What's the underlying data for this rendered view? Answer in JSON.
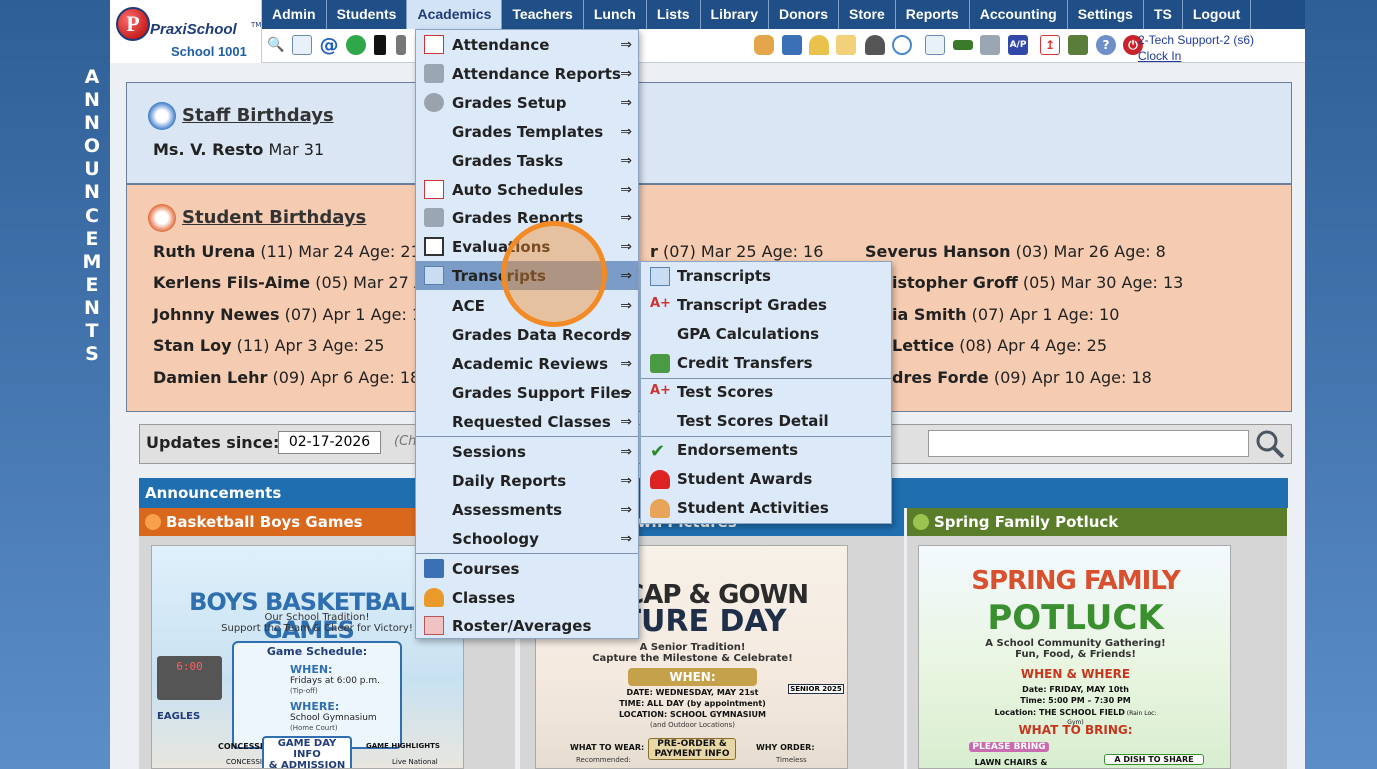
{
  "side_label": [
    "A",
    "N",
    "N",
    "O",
    "U",
    "N",
    "C",
    "E",
    "M",
    "E",
    "N",
    "T",
    "S"
  ],
  "logo": {
    "mark": "P",
    "brand": "PraxiSchool",
    "tm": "TM",
    "school": "School 1001"
  },
  "nav": [
    "Admin",
    "Students",
    "Academics",
    "Teachers",
    "Lunch",
    "Lists",
    "Library",
    "Donors",
    "Store",
    "Reports",
    "Accounting",
    "Settings",
    "TS",
    "Logout"
  ],
  "toolbar": {
    "user": "2-Tech Support-2 (s6)",
    "clock_in": "Clock In"
  },
  "staff": {
    "title": "Staff Birthdays",
    "entries": [
      {
        "name": "Ms. V. Resto",
        "info": " Mar 31"
      }
    ]
  },
  "students": {
    "title": "Student Birthdays",
    "col1": [
      {
        "name": "Ruth Urena",
        "info": " (11) Mar 24 Age: 21"
      },
      {
        "name": "Kerlens Fils-Aime",
        "info": " (05) Mar 27 Age"
      },
      {
        "name": "Johnny Newes",
        "info": " (07) Apr 1 Age: 15"
      },
      {
        "name": "Stan Loy",
        "info": " (11) Apr 3 Age: 25"
      },
      {
        "name": "Damien Lehr",
        "info": " (09) Apr 6 Age: 18"
      }
    ],
    "col2": [
      {
        "name": "r",
        "info": " (07) Mar 25 Age: 16"
      }
    ],
    "col3": [
      {
        "name": "Severus Hanson",
        "info": " (03) Mar 26 Age: 8"
      },
      {
        "name": "istopher Groff",
        "info": " (05) Mar 30 Age: 13"
      },
      {
        "name": "ia Smith",
        "info": " (07) Apr 1 Age: 10"
      },
      {
        "name": "Lettice",
        "info": " (08) Apr 4 Age: 25"
      },
      {
        "name": "dres Forde",
        "info": " (09) Apr 10 Age: 18"
      }
    ]
  },
  "updates": {
    "label": "Updates since:",
    "date": "02-17-2026",
    "hint": "(Ch"
  },
  "announcements": {
    "header": "Announcements",
    "cols": [
      {
        "title": "Basketball Boys Games",
        "color": "#d9671c"
      },
      {
        "title": "r Cap & Gown Pictures",
        "color": "#1f6fb0"
      },
      {
        "title": "Spring Family Potluck",
        "color": "#5a7d2a"
      }
    ],
    "poster1": {
      "title": "BOYS BASKETBALL GAMES",
      "sub": "Our School Tradition!\nSupport the Team & Cheer for Victory!",
      "schedule": "Game Schedule:",
      "when": "WHEN:",
      "when_val": "Fridays at 6:00 p.m.",
      "tipoff": "(Tip-off)",
      "where": "WHERE:",
      "where_val": "School Gymnasium",
      "court": "(Home Court)",
      "score": "6:00",
      "eagles": "EAGLES",
      "concessions": "CONCESSIONS:",
      "concession": "CONCESSION",
      "gameday": "GAME DAY INFO\n& ADMISSION",
      "highlights": "GAME HIGHLIGHTS",
      "live": "Live National"
    },
    "poster2": {
      "title1": "OR CAP & GOWN",
      "title2": "CTURE DAY",
      "sub": "A Senior Tradition!\nCapture the Milestone & Celebrate!",
      "when": "WHEN:",
      "date": "DATE: WEDNESDAY, MAY 21st",
      "time": "TIME: ALL DAY (by appointment)",
      "loc": "LOCATION: SCHOOL GYMNASIUM",
      "loc2": "(and Outdoor Locations)",
      "senior": "SENIOR 2025",
      "wear": "WHAT TO WEAR:",
      "rec": "Recommended:",
      "pre": "PRE-ORDER &\nPAYMENT INFO",
      "why": "WHY ORDER:",
      "timeless": "Timeless"
    },
    "poster3": {
      "title1": "SPRING FAMILY",
      "title2": "POTLUCK",
      "sub": "A School Community Gathering!\nFun, Food, & Friends!",
      "whenwhere": "WHEN & WHERE",
      "date": "Date: FRIDAY, MAY 10th",
      "time": "Time: 5:00 PM – 7:30 PM",
      "loc": "Location: THE SCHOOL FIELD",
      "loc2": " (Rain Loc: Gym)",
      "bring": "WHAT TO BRING:",
      "please": "PLEASE BRING",
      "chairs": "LAWN CHAIRS &",
      "dish": "A DISH TO SHARE"
    }
  },
  "menu": {
    "items": [
      {
        "label": "Attendance",
        "arrow": "⇒"
      },
      {
        "label": "Attendance Reports",
        "arrow": "⇒"
      },
      {
        "label": "Grades Setup",
        "arrow": "⇒"
      },
      {
        "label": "Grades Templates",
        "arrow": "⇒"
      },
      {
        "label": "Grades Tasks",
        "arrow": "⇒"
      },
      {
        "label": "Auto Schedules",
        "arrow": "⇒"
      },
      {
        "label": "Grades Reports",
        "arrow": "⇒"
      },
      {
        "label": "Evaluations",
        "arrow": "⇒"
      },
      {
        "label": "Transcripts",
        "arrow": "⇒"
      },
      {
        "label": "ACE",
        "arrow": "⇒"
      },
      {
        "label": "Grades Data Records",
        "arrow": "⇒"
      },
      {
        "label": "Academic Reviews",
        "arrow": "⇒"
      },
      {
        "label": "Grades Support Files",
        "arrow": "⇒"
      },
      {
        "label": "Requested Classes",
        "arrow": "⇒"
      },
      {
        "label": "Sessions",
        "arrow": "⇒"
      },
      {
        "label": "Daily Reports",
        "arrow": "⇒"
      },
      {
        "label": "Assessments",
        "arrow": "⇒"
      },
      {
        "label": "Schoology",
        "arrow": "⇒"
      },
      {
        "label": "Courses",
        "arrow": ""
      },
      {
        "label": "Classes",
        "arrow": ""
      },
      {
        "label": "Roster/Averages",
        "arrow": ""
      }
    ]
  },
  "submenu": {
    "items": [
      {
        "label": "Transcripts"
      },
      {
        "label": "Transcript Grades"
      },
      {
        "label": "GPA Calculations"
      },
      {
        "label": "Credit Transfers"
      },
      {
        "label": "Test Scores"
      },
      {
        "label": "Test Scores Detail"
      },
      {
        "label": "Endorsements"
      },
      {
        "label": "Student Awards"
      },
      {
        "label": "Student Activities"
      }
    ]
  }
}
